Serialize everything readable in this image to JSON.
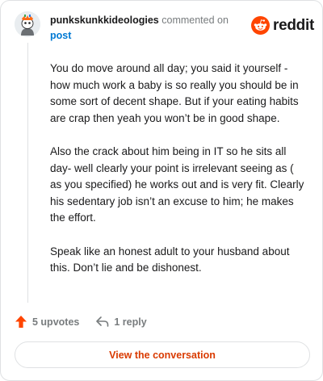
{
  "header": {
    "username": "punkskunkkideologies",
    "commented_on": "commented on",
    "post_link": "post"
  },
  "brand": {
    "icon": "reddit-snoo-icon",
    "wordmark": "reddit",
    "color": "#ff4500"
  },
  "comment": {
    "paragraphs": [
      "You do move around all day; you said it yourself - how much work a baby is so really you should be in some sort of decent shape. But if your eating habits are crap then yeah you won’t be in good shape.",
      "Also the crack about him being in IT so he sits all day- well clearly your point is irrelevant seeing as ( as you specified) he works out and is very fit. Clearly his sedentary job isn’t an excuse to him; he makes the effort.",
      "Speak like an honest adult to your husband about this. Don’t lie and be dishonest."
    ]
  },
  "actions": {
    "upvotes_label": "5 upvotes",
    "reply_label": "1 reply",
    "upvote_color": "#ff4500"
  },
  "footer": {
    "view_button_label": "View the conversation",
    "button_text_color": "#d93a00"
  }
}
